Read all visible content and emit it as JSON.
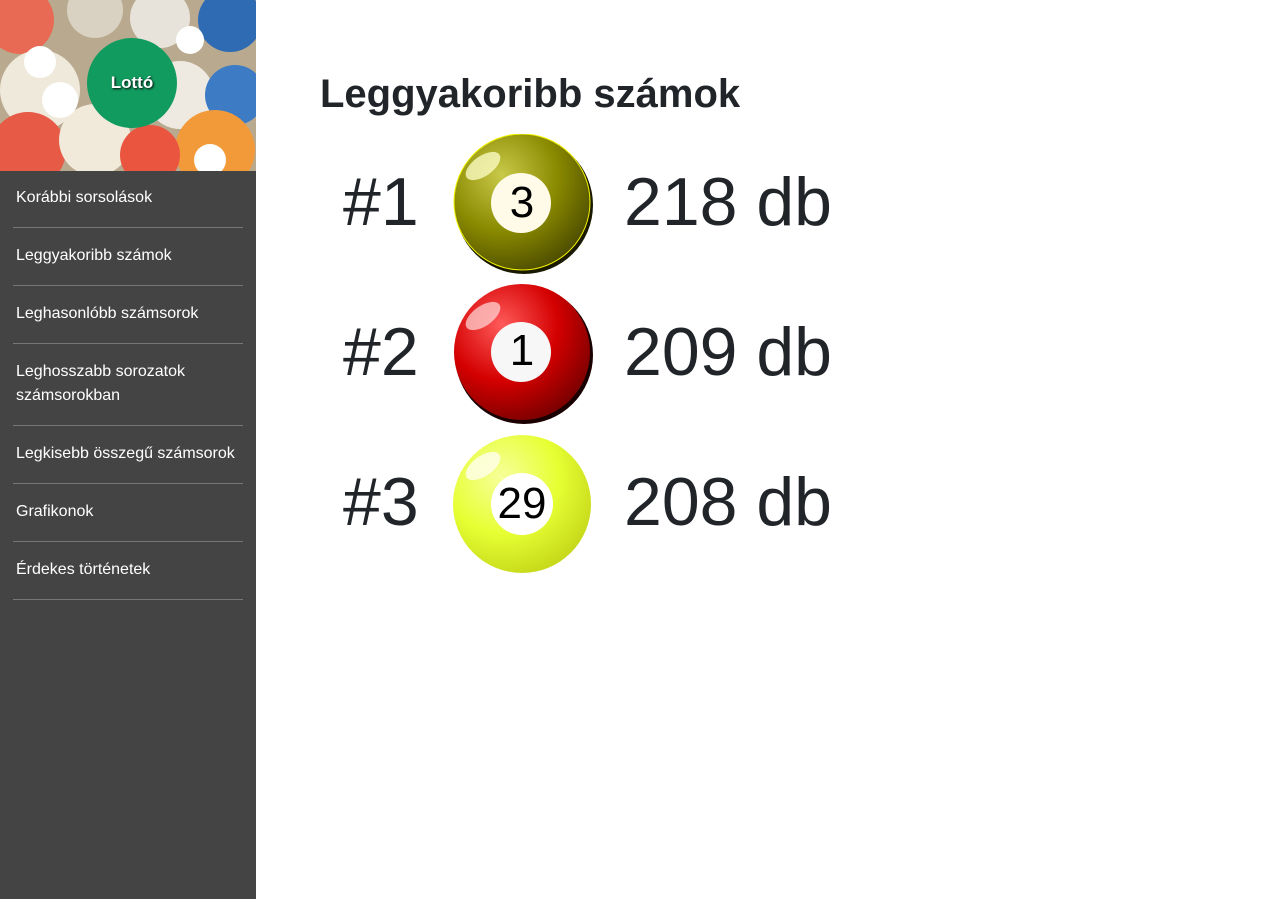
{
  "logo": {
    "label": "Lottó"
  },
  "sidebar": {
    "items": [
      {
        "label": "Korábbi sorsolások"
      },
      {
        "label": "Leggyakoribb számok"
      },
      {
        "label": "Leghasonlóbb számsorok"
      },
      {
        "label": "Leghosszabb sorozatok számsorokban"
      },
      {
        "label": "Legkisebb összegű számsorok"
      },
      {
        "label": "Grafikonok"
      },
      {
        "label": "Érdekes történetek"
      }
    ]
  },
  "main": {
    "title": "Leggyakoribb számok",
    "rankings": [
      {
        "rank": "#1",
        "number": "3",
        "count": "218 db",
        "ball_color": "#8a8a00"
      },
      {
        "rank": "#2",
        "number": "1",
        "count": "209 db",
        "ball_color": "#d40000"
      },
      {
        "rank": "#3",
        "number": "29",
        "count": "208 db",
        "ball_color": "#e6ff33"
      }
    ]
  }
}
